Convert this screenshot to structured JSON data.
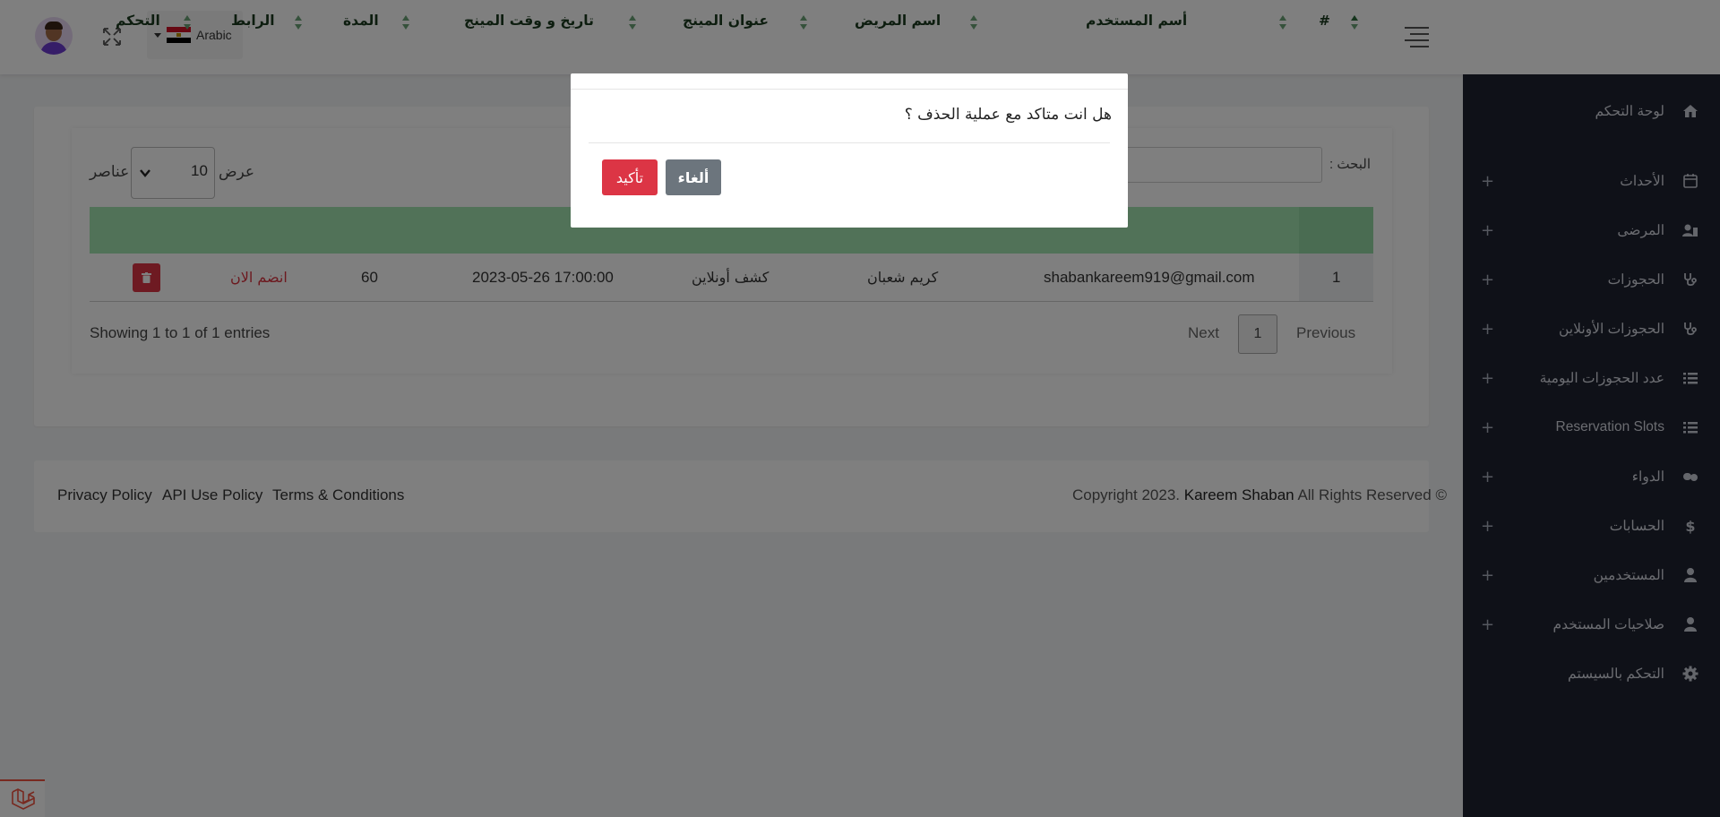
{
  "header": {
    "language_label": "Arabic",
    "icons": {
      "avatar": "user-avatar",
      "fullscreen": "expand-icon",
      "flag": "egypt-flag-icon",
      "menu": "hamburger-icon"
    }
  },
  "sidebar": {
    "items": [
      {
        "label": "لوحة التحكم",
        "icon": "home-icon",
        "expandable": false
      },
      {
        "label": "الأحداث",
        "icon": "calendar-icon",
        "expandable": true
      },
      {
        "label": "المرضى",
        "icon": "patient-icon",
        "expandable": true
      },
      {
        "label": "الحجوزات",
        "icon": "stethoscope-icon",
        "expandable": true
      },
      {
        "label": "الحجوزات الأونلاين",
        "icon": "stethoscope-icon",
        "expandable": true
      },
      {
        "label": "عدد الحجوزات اليومية",
        "icon": "list-icon",
        "expandable": true
      },
      {
        "label": "Reservation Slots",
        "icon": "list-icon",
        "expandable": true
      },
      {
        "label": "الدواء",
        "icon": "pills-icon",
        "expandable": true
      },
      {
        "label": "الحسابات",
        "icon": "dollar-icon",
        "expandable": true
      },
      {
        "label": "المستخدمين",
        "icon": "user-icon",
        "expandable": true
      },
      {
        "label": "صلاحيات المستخدم",
        "icon": "user-icon",
        "expandable": true
      },
      {
        "label": "التحكم بالسيستم",
        "icon": "gear-icon",
        "expandable": false
      }
    ],
    "plus_symbol": "+"
  },
  "table_controls": {
    "show_label": "عرض",
    "entries_label": "عناصر",
    "page_length": "10",
    "search_label": "البحث :"
  },
  "table": {
    "columns": [
      "#",
      "أسم المستخدم",
      "اسم المريض",
      "عنوان المينج",
      "تاريخ و وقت المينج",
      "المدة",
      "الرابط",
      "التحكم"
    ],
    "rows": [
      {
        "num": "1",
        "user": "shabankareem919@gmail.com",
        "patient": "كريم شعبان",
        "title": "كشف أونلاين",
        "datetime": "2023-05-26 17:00:00",
        "duration": "60",
        "link": "انضم الان"
      }
    ]
  },
  "pagination": {
    "info": "Showing 1 to 1 of 1 entries",
    "previous": "Previous",
    "current": "1",
    "next": "Next"
  },
  "footer": {
    "links": [
      "Privacy Policy",
      "API Use Policy",
      "Terms & Conditions"
    ],
    "copyright_prefix": "Copyright 2023.",
    "author": "Kareem Shaban",
    "copyright_suffix": "All Rights Reserved ©"
  },
  "modal": {
    "message": "هل انت متاكد مع عملية الحذف ؟",
    "confirm_label": "تأكيد",
    "cancel_label": "ألغاء"
  },
  "colors": {
    "sidebar_bg": "#1e2230",
    "table_header": "#a3e4b1",
    "danger": "#dc3545",
    "secondary": "#6c757d"
  }
}
